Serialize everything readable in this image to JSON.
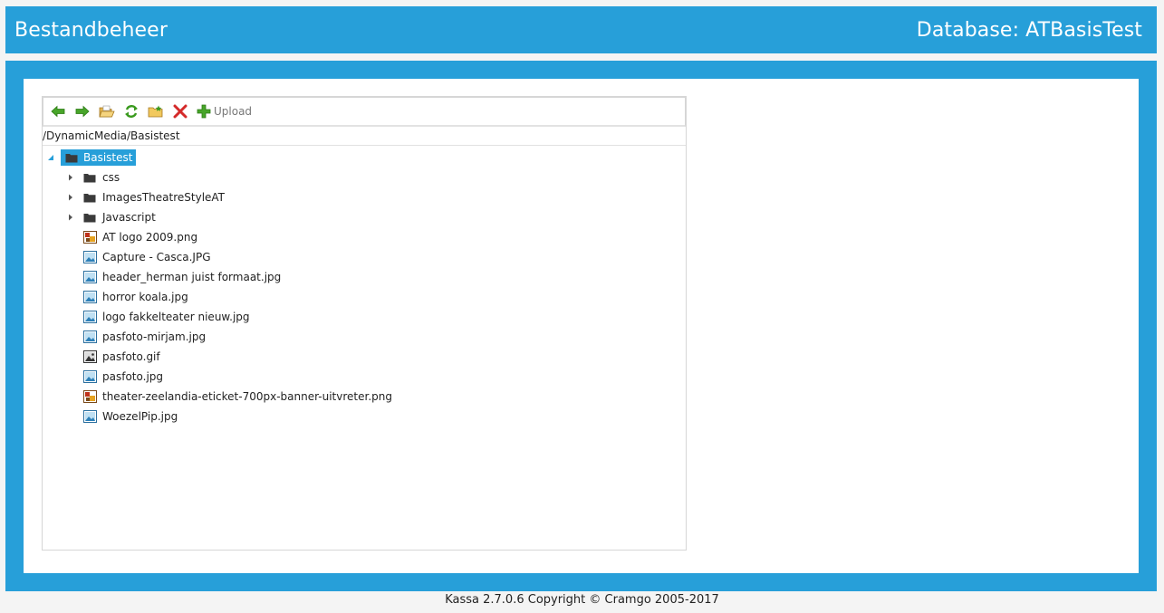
{
  "header": {
    "title": "Bestandbeheer",
    "database_label": "Database: ATBasisTest"
  },
  "toolbar": {
    "buttons": [
      {
        "name": "back-icon",
        "color": "#3a9a1e"
      },
      {
        "name": "forward-icon",
        "color": "#3a9a1e"
      },
      {
        "name": "open-folder-icon",
        "color": "#e8b84a"
      },
      {
        "name": "refresh-icon",
        "color": "#3a9a1e"
      },
      {
        "name": "new-folder-icon",
        "color": "#e8b84a"
      },
      {
        "name": "delete-icon",
        "color": "#d42a2a"
      }
    ],
    "upload_label": "Upload"
  },
  "path": "/DynamicMedia/Basistest",
  "tree": {
    "root": {
      "label": "Basistest",
      "expanded": true
    },
    "folders": [
      {
        "label": "css"
      },
      {
        "label": "ImagesTheatreStyleAT"
      },
      {
        "label": "Javascript"
      }
    ],
    "files": [
      {
        "label": "AT logo 2009.png",
        "type": "png"
      },
      {
        "label": "Capture - Casca.JPG",
        "type": "jpg"
      },
      {
        "label": "header_herman juist formaat.jpg",
        "type": "jpg"
      },
      {
        "label": "horror koala.jpg",
        "type": "jpg"
      },
      {
        "label": "logo fakkelteater nieuw.jpg",
        "type": "jpg"
      },
      {
        "label": "pasfoto-mirjam.jpg",
        "type": "jpg"
      },
      {
        "label": "pasfoto.gif",
        "type": "gif"
      },
      {
        "label": "pasfoto.jpg",
        "type": "jpg"
      },
      {
        "label": "theater-zeelandia-eticket-700px-banner-uitvreter.png",
        "type": "png"
      },
      {
        "label": "WoezelPip.jpg",
        "type": "jpg"
      }
    ]
  },
  "footer": "Kassa 2.7.0.6 Copyright © Cramgo 2005-2017",
  "colors": {
    "accent": "#279fd9"
  }
}
